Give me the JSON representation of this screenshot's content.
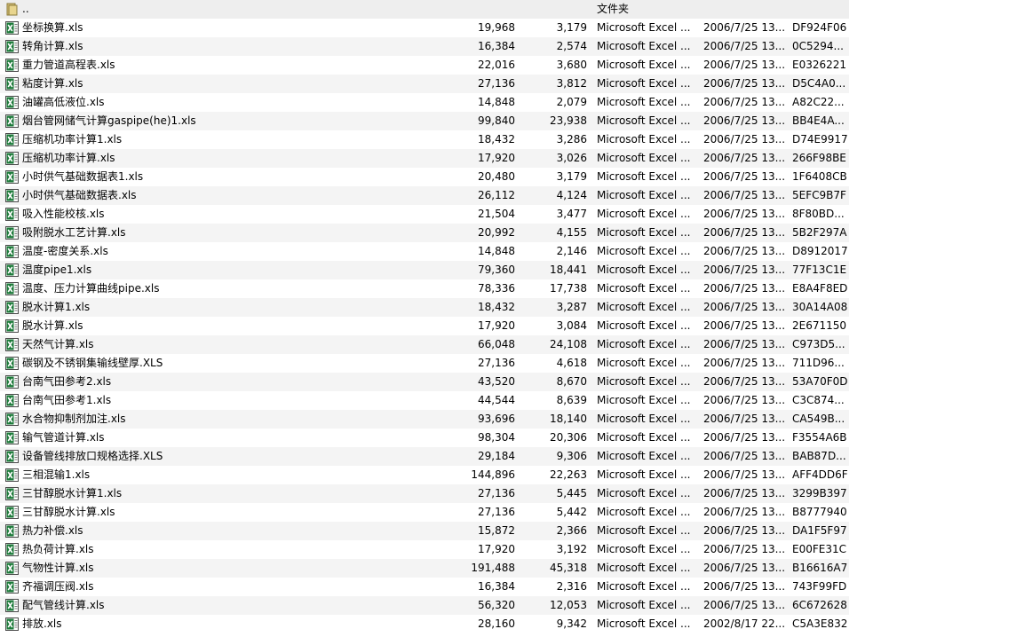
{
  "parent_row": {
    "name": "..",
    "type": "文件夹"
  },
  "files": [
    {
      "name": "坐标换算.xls",
      "size": "19,968",
      "packed": "3,179",
      "type": "Microsoft Excel ...",
      "modified": "2006/7/25 13...",
      "crc": "DF924F06"
    },
    {
      "name": "转角计算.xls",
      "size": "16,384",
      "packed": "2,574",
      "type": "Microsoft Excel ...",
      "modified": "2006/7/25 13...",
      "crc": "0C5294..."
    },
    {
      "name": "重力管道高程表.xls",
      "size": "22,016",
      "packed": "3,680",
      "type": "Microsoft Excel ...",
      "modified": "2006/7/25 13...",
      "crc": "E0326221"
    },
    {
      "name": "粘度计算.xls",
      "size": "27,136",
      "packed": "3,812",
      "type": "Microsoft Excel ...",
      "modified": "2006/7/25 13...",
      "crc": "D5C4A0..."
    },
    {
      "name": "油罐高低液位.xls",
      "size": "14,848",
      "packed": "2,079",
      "type": "Microsoft Excel ...",
      "modified": "2006/7/25 13...",
      "crc": "A82C22..."
    },
    {
      "name": "烟台管网储气计算gaspipe(he)1.xls",
      "size": "99,840",
      "packed": "23,938",
      "type": "Microsoft Excel ...",
      "modified": "2006/7/25 13...",
      "crc": "BB4E4A..."
    },
    {
      "name": "压缩机功率计算1.xls",
      "size": "18,432",
      "packed": "3,286",
      "type": "Microsoft Excel ...",
      "modified": "2006/7/25 13...",
      "crc": "D74E9917"
    },
    {
      "name": "压缩机功率计算.xls",
      "size": "17,920",
      "packed": "3,026",
      "type": "Microsoft Excel ...",
      "modified": "2006/7/25 13...",
      "crc": "266F98BE"
    },
    {
      "name": "小时供气基础数据表1.xls",
      "size": "20,480",
      "packed": "3,179",
      "type": "Microsoft Excel ...",
      "modified": "2006/7/25 13...",
      "crc": "1F6408CB"
    },
    {
      "name": "小时供气基础数据表.xls",
      "size": "26,112",
      "packed": "4,124",
      "type": "Microsoft Excel ...",
      "modified": "2006/7/25 13...",
      "crc": "5EFC9B7F"
    },
    {
      "name": "吸入性能校核.xls",
      "size": "21,504",
      "packed": "3,477",
      "type": "Microsoft Excel ...",
      "modified": "2006/7/25 13...",
      "crc": "8F80BD..."
    },
    {
      "name": "吸附脱水工艺计算.xls",
      "size": "20,992",
      "packed": "4,155",
      "type": "Microsoft Excel ...",
      "modified": "2006/7/25 13...",
      "crc": "5B2F297A"
    },
    {
      "name": "温度-密度关系.xls",
      "size": "14,848",
      "packed": "2,146",
      "type": "Microsoft Excel ...",
      "modified": "2006/7/25 13...",
      "crc": "D8912017"
    },
    {
      "name": "温度pipe1.xls",
      "size": "79,360",
      "packed": "18,441",
      "type": "Microsoft Excel ...",
      "modified": "2006/7/25 13...",
      "crc": "77F13C1E"
    },
    {
      "name": "温度、压力计算曲线pipe.xls",
      "size": "78,336",
      "packed": "17,738",
      "type": "Microsoft Excel ...",
      "modified": "2006/7/25 13...",
      "crc": "E8A4F8ED"
    },
    {
      "name": "脱水计算1.xls",
      "size": "18,432",
      "packed": "3,287",
      "type": "Microsoft Excel ...",
      "modified": "2006/7/25 13...",
      "crc": "30A14A08"
    },
    {
      "name": "脱水计算.xls",
      "size": "17,920",
      "packed": "3,084",
      "type": "Microsoft Excel ...",
      "modified": "2006/7/25 13...",
      "crc": "2E671150"
    },
    {
      "name": "天然气计算.xls",
      "size": "66,048",
      "packed": "24,108",
      "type": "Microsoft Excel ...",
      "modified": "2006/7/25 13...",
      "crc": "C973D5..."
    },
    {
      "name": "碳钢及不锈钢集输线壁厚.XLS",
      "size": "27,136",
      "packed": "4,618",
      "type": "Microsoft Excel ...",
      "modified": "2006/7/25 13...",
      "crc": "711D96..."
    },
    {
      "name": "台南气田参考2.xls",
      "size": "43,520",
      "packed": "8,670",
      "type": "Microsoft Excel ...",
      "modified": "2006/7/25 13...",
      "crc": "53A70F0D"
    },
    {
      "name": "台南气田参考1.xls",
      "size": "44,544",
      "packed": "8,639",
      "type": "Microsoft Excel ...",
      "modified": "2006/7/25 13...",
      "crc": "C3C874..."
    },
    {
      "name": "水合物抑制剂加注.xls",
      "size": "93,696",
      "packed": "18,140",
      "type": "Microsoft Excel ...",
      "modified": "2006/7/25 13...",
      "crc": "CA549B..."
    },
    {
      "name": "输气管道计算.xls",
      "size": "98,304",
      "packed": "20,306",
      "type": "Microsoft Excel ...",
      "modified": "2006/7/25 13...",
      "crc": "F3554A6B"
    },
    {
      "name": "设备管线排放口规格选择.XLS",
      "size": "29,184",
      "packed": "9,306",
      "type": "Microsoft Excel ...",
      "modified": "2006/7/25 13...",
      "crc": "BAB87D..."
    },
    {
      "name": "三相混输1.xls",
      "size": "144,896",
      "packed": "22,263",
      "type": "Microsoft Excel ...",
      "modified": "2006/7/25 13...",
      "crc": "AFF4DD6F"
    },
    {
      "name": "三甘醇脱水计算1.xls",
      "size": "27,136",
      "packed": "5,445",
      "type": "Microsoft Excel ...",
      "modified": "2006/7/25 13...",
      "crc": "3299B397"
    },
    {
      "name": "三甘醇脱水计算.xls",
      "size": "27,136",
      "packed": "5,442",
      "type": "Microsoft Excel ...",
      "modified": "2006/7/25 13...",
      "crc": "B8777940"
    },
    {
      "name": "热力补偿.xls",
      "size": "15,872",
      "packed": "2,366",
      "type": "Microsoft Excel ...",
      "modified": "2006/7/25 13...",
      "crc": "DA1F5F97"
    },
    {
      "name": "热负荷计算.xls",
      "size": "17,920",
      "packed": "3,192",
      "type": "Microsoft Excel ...",
      "modified": "2006/7/25 13...",
      "crc": "E00FE31C"
    },
    {
      "name": "气物性计算.xls",
      "size": "191,488",
      "packed": "45,318",
      "type": "Microsoft Excel ...",
      "modified": "2006/7/25 13...",
      "crc": "B16616A7"
    },
    {
      "name": "齐福调压阀.xls",
      "size": "16,384",
      "packed": "2,316",
      "type": "Microsoft Excel ...",
      "modified": "2006/7/25 13...",
      "crc": "743F99FD"
    },
    {
      "name": "配气管线计算.xls",
      "size": "56,320",
      "packed": "12,053",
      "type": "Microsoft Excel ...",
      "modified": "2006/7/25 13...",
      "crc": "6C672628"
    },
    {
      "name": "排放.xls",
      "size": "28,160",
      "packed": "9,342",
      "type": "Microsoft Excel ...",
      "modified": "2002/8/17 22...",
      "crc": "C5A3E832"
    }
  ]
}
